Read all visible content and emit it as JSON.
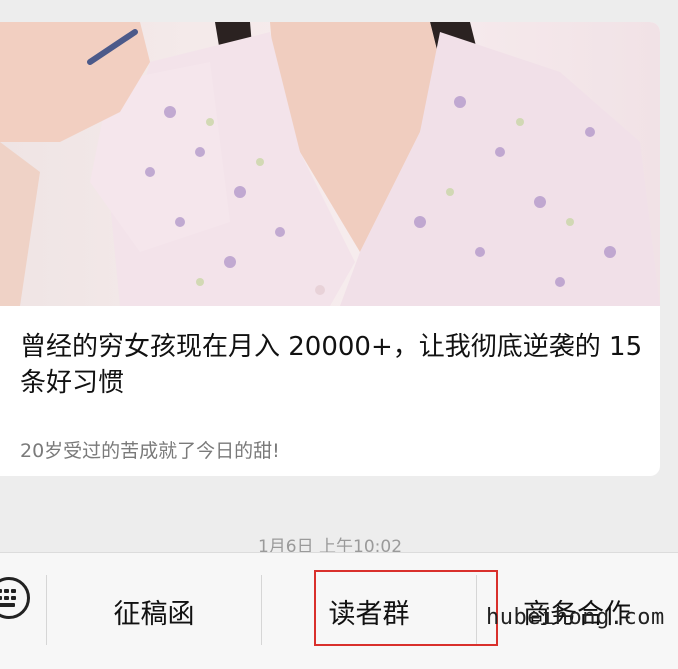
{
  "article": {
    "title": "曾经的穷女孩现在月入 20000+，让我彻底逆袭的 15 条好习惯",
    "subtitle": "20岁受过的苦成就了今日的甜!"
  },
  "timestamp": "1月6日 上午10:02",
  "menu": {
    "items": [
      {
        "label": "征稿函"
      },
      {
        "label": "读者群"
      },
      {
        "label": "商务合作"
      }
    ]
  },
  "icons": {
    "keyboard": "keyboard-icon"
  },
  "watermark": "hubeihong.com",
  "colors": {
    "highlight_box": "#d9302c"
  }
}
